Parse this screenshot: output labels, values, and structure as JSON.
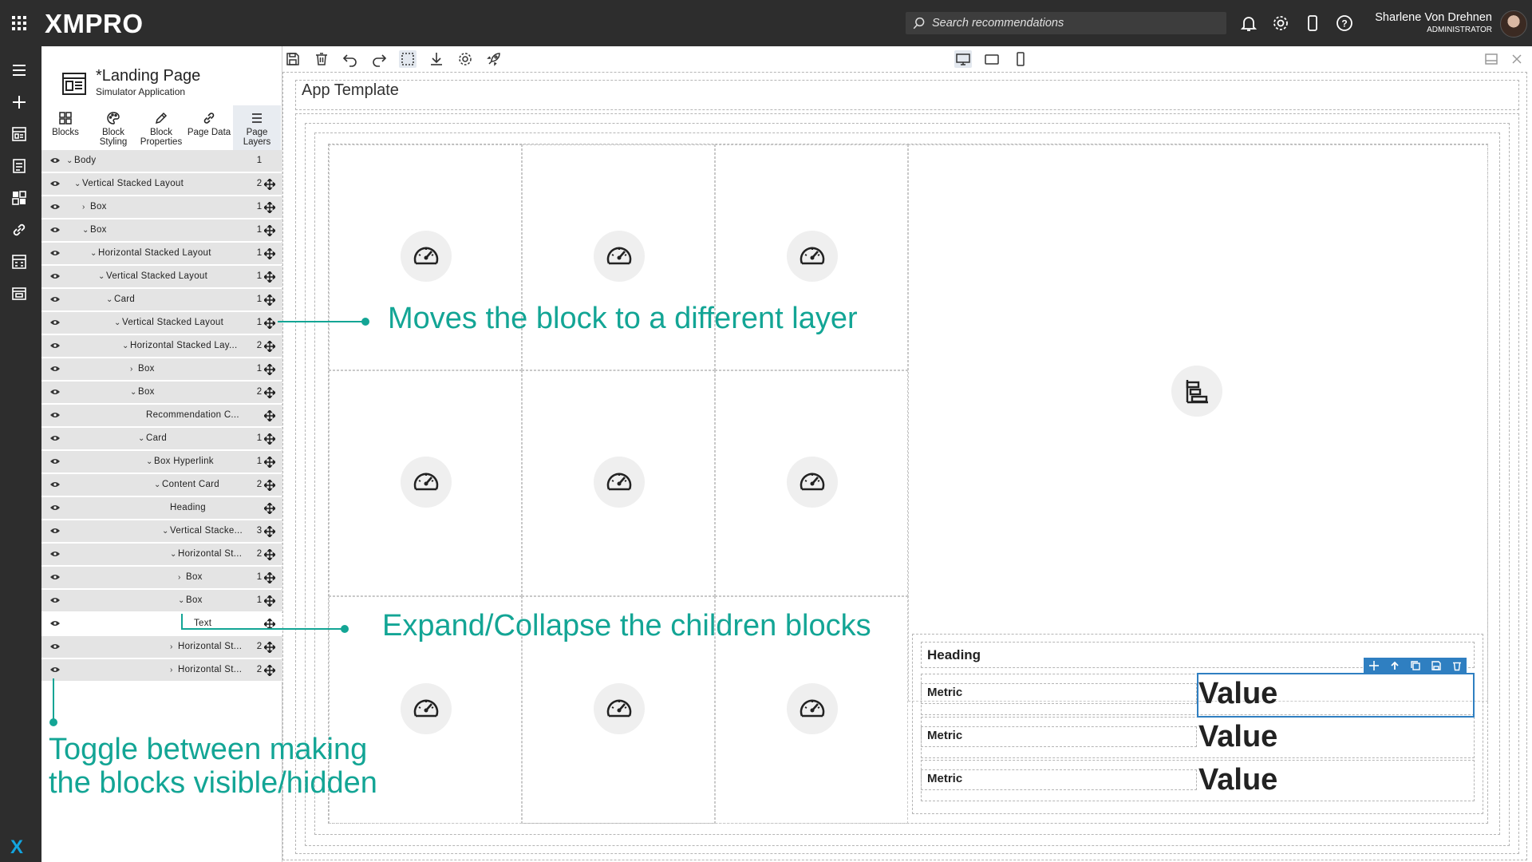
{
  "topbar": {
    "brand": "XMPRO",
    "search_placeholder": "Search recommendations",
    "user_name": "Sharlene Von Drehnen",
    "user_role": "ADMINISTRATOR"
  },
  "panel": {
    "page_title": "*Landing Page",
    "page_subtitle": "Simulator Application",
    "tabs": [
      {
        "label": "Blocks",
        "icon": "blocks-grid-icon"
      },
      {
        "label": "Block Styling",
        "icon": "palette-icon"
      },
      {
        "label": "Block Properties",
        "icon": "pencil-icon"
      },
      {
        "label": "Page Data",
        "icon": "link-icon"
      },
      {
        "label": "Page Layers",
        "icon": "layers-icon"
      }
    ],
    "active_tab": "Page Layers",
    "layers": [
      {
        "label": "Body",
        "count": "1",
        "depth": 0,
        "chevron": "down",
        "movable": false
      },
      {
        "label": "Vertical Stacked Layout",
        "count": "2",
        "depth": 1,
        "chevron": "down",
        "movable": true
      },
      {
        "label": "Box",
        "count": "1",
        "depth": 2,
        "chevron": "right",
        "movable": true
      },
      {
        "label": "Box",
        "count": "1",
        "depth": 2,
        "chevron": "down",
        "movable": true
      },
      {
        "label": "Horizontal Stacked Layout",
        "count": "1",
        "depth": 3,
        "chevron": "down",
        "movable": true
      },
      {
        "label": "Vertical Stacked Layout",
        "count": "1",
        "depth": 4,
        "chevron": "down",
        "movable": true
      },
      {
        "label": "Card",
        "count": "1",
        "depth": 5,
        "chevron": "down",
        "movable": true
      },
      {
        "label": "Vertical Stacked Layout",
        "count": "1",
        "depth": 6,
        "chevron": "down",
        "movable": true
      },
      {
        "label": "Horizontal Stacked Lay...",
        "count": "2",
        "depth": 7,
        "chevron": "down",
        "movable": true
      },
      {
        "label": "Box",
        "count": "1",
        "depth": 8,
        "chevron": "right",
        "movable": true
      },
      {
        "label": "Box",
        "count": "2",
        "depth": 8,
        "chevron": "down",
        "movable": true
      },
      {
        "label": "Recommendation C...",
        "count": "",
        "depth": 9,
        "chevron": "",
        "movable": true
      },
      {
        "label": "Card",
        "count": "1",
        "depth": 9,
        "chevron": "down",
        "movable": true
      },
      {
        "label": "Box Hyperlink",
        "count": "1",
        "depth": 10,
        "chevron": "down",
        "movable": true
      },
      {
        "label": "Content Card",
        "count": "2",
        "depth": 11,
        "chevron": "down",
        "movable": true
      },
      {
        "label": "Heading",
        "count": "",
        "depth": 12,
        "chevron": "",
        "movable": true
      },
      {
        "label": "Vertical Stacke...",
        "count": "3",
        "depth": 12,
        "chevron": "down",
        "movable": true
      },
      {
        "label": "Horizontal St...",
        "count": "2",
        "depth": 13,
        "chevron": "down",
        "movable": true
      },
      {
        "label": "Box",
        "count": "1",
        "depth": 14,
        "chevron": "right",
        "movable": true
      },
      {
        "label": "Box",
        "count": "1",
        "depth": 14,
        "chevron": "down",
        "movable": true
      },
      {
        "label": "Text",
        "count": "",
        "depth": 15,
        "chevron": "",
        "movable": true,
        "selected": true
      },
      {
        "label": "Horizontal St...",
        "count": "2",
        "depth": 13,
        "chevron": "right",
        "movable": true
      },
      {
        "label": "Horizontal St...",
        "count": "2",
        "depth": 13,
        "chevron": "right",
        "movable": true
      }
    ]
  },
  "canvas": {
    "template_title": "App Template",
    "card": {
      "heading": "Heading",
      "rows": [
        {
          "metric": "Metric",
          "value": "Value"
        },
        {
          "metric": "Metric",
          "value": "Value"
        },
        {
          "metric": "Metric",
          "value": "Value"
        }
      ]
    }
  },
  "callouts": {
    "move_layer": "Moves the block to a different layer",
    "expand_collapse": "Expand/Collapse the children blocks",
    "toggle_line1": "Toggle between making",
    "toggle_line2": "the blocks visible/hidden"
  },
  "colors": {
    "topbar_bg": "#2d2d2d",
    "accent_teal": "#13a595",
    "selection_blue": "#2f7fc1",
    "layer_row_bg": "#e4e4e4"
  }
}
